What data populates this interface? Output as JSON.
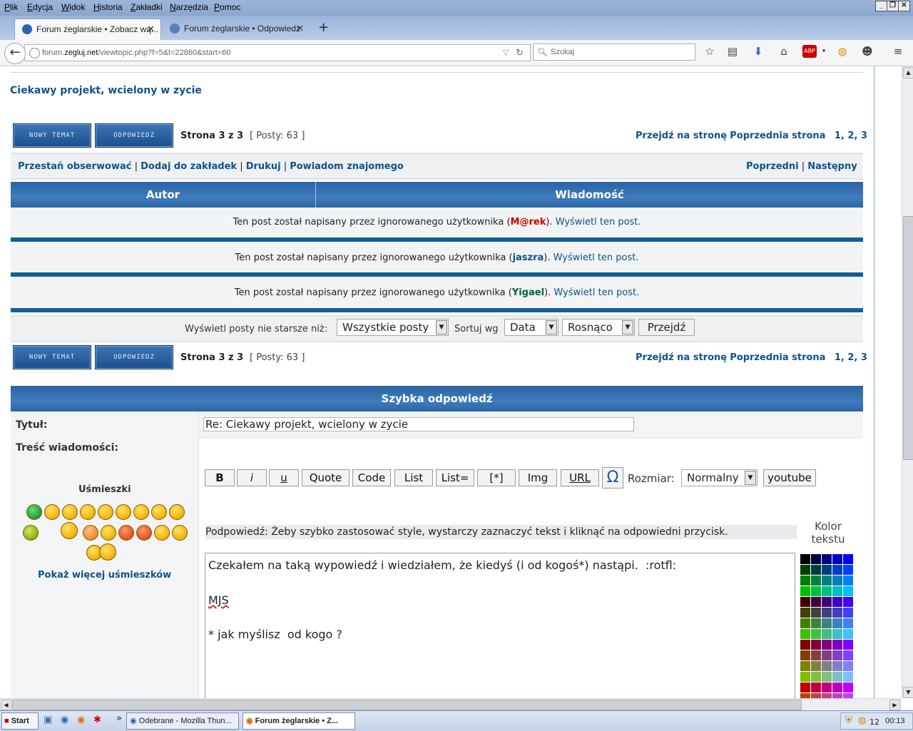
{
  "browser": {
    "menu": [
      "Plik",
      "Edycja",
      "Widok",
      "Historia",
      "Zakładki",
      "Narzędzia",
      "Pomoc"
    ],
    "tabs": [
      {
        "label": "Forum żeglarskie • Zobacz wą...",
        "active": true
      },
      {
        "label": "Forum żeglarskie • Odpowiedz",
        "active": false
      }
    ],
    "new_tab": "+",
    "url_prefix": "forum.",
    "url_host": "zegluj.net",
    "url_path": "/viewtopic.php?f=5&t=22860&start=60",
    "search_placeholder": "Szukaj"
  },
  "topic": {
    "title": "Ciekawy projekt, wcielony w zycie"
  },
  "buttons": {
    "new_topic": "NOWY TEMAT",
    "reply": "ODPOWIEDZ"
  },
  "pagination": {
    "page_info": "Strona 3 z 3",
    "posts_info": "[ Posty: 63 ]",
    "goto_label": "Przejdź na stronę",
    "prev_label": "Poprzednia strona",
    "pages": [
      "1",
      ", ",
      "2",
      ", ",
      "3"
    ]
  },
  "actions": {
    "unwatch": "Przestań obserwować",
    "bookmark": "Dodaj do zakładek",
    "print": "Drukuj",
    "notify": "Powiadom znajomego",
    "sep": "|",
    "prev": "Poprzedni",
    "next": "Następny"
  },
  "table": {
    "col_author": "Autor",
    "col_message": "Wiadomość"
  },
  "ignored_posts": [
    {
      "prefix": "Ten post został napisany przez ignorowanego użytkownika (",
      "user": "M@rek",
      "suffix": "). ",
      "link": "Wyświetl ten post.",
      "user_color": "#cc0000"
    },
    {
      "prefix": "Ten post został napisany przez ignorowanego użytkownika (",
      "user": "jaszra",
      "suffix": "). ",
      "link": "Wyświetl ten post.",
      "user_color": "#105289"
    },
    {
      "prefix": "Ten post został napisany przez ignorowanego użytkownika (",
      "user": "Yigael",
      "suffix": "). ",
      "link": "Wyświetl ten post.",
      "user_color": "#00663a"
    }
  ],
  "filter": {
    "show_label": "Wyświetl posty nie starsze niż:",
    "show_value": "Wszystkie posty",
    "sort_label": "Sortuj wg",
    "sort_value": "Data",
    "order_value": "Rosnąco",
    "go": "Przejdź"
  },
  "quick_reply": {
    "header": "Szybka odpowiedź",
    "title_label": "Tytuł:",
    "title_value": "Re: Ciekawy projekt, wcielony w zycie",
    "body_label": "Treść wiadomości:",
    "smilies_label": "Uśmieszki",
    "more_smilies": "Pokaż więcej uśmieszków",
    "fmt_buttons": [
      "B",
      "i",
      "u",
      "Quote",
      "Code",
      "List",
      "List=",
      "[*]",
      "Img",
      "URL"
    ],
    "omega": "Ω",
    "size_label": "Rozmiar:",
    "size_value": "Normalny",
    "youtube": "youtube",
    "hint": "Podpowiedź: Żeby szybko zastosować style, wystarczy zaznaczyć tekst i kliknąć na odpowiedni przycisk.",
    "color_label_1": "Kolor",
    "color_label_2": "tekstu",
    "body_lines": [
      "Czekałem na taką wypowiedź i wiedziałem, że kiedyś (i od kogoś*) nastąpi.  :rotfl:",
      "",
      "MJS",
      "",
      "* jak myślisz  od kogo ?"
    ]
  },
  "taskbar": {
    "start": "Start",
    "chevron": "»",
    "tasks": [
      "Odebrane - Mozilla Thun...",
      "Forum żeglarskie • Z..."
    ],
    "tray_count": "12",
    "clock": "00:13"
  },
  "colors": {
    "link": "#105289",
    "header": "#2a63a0",
    "separator": "#105e98"
  }
}
